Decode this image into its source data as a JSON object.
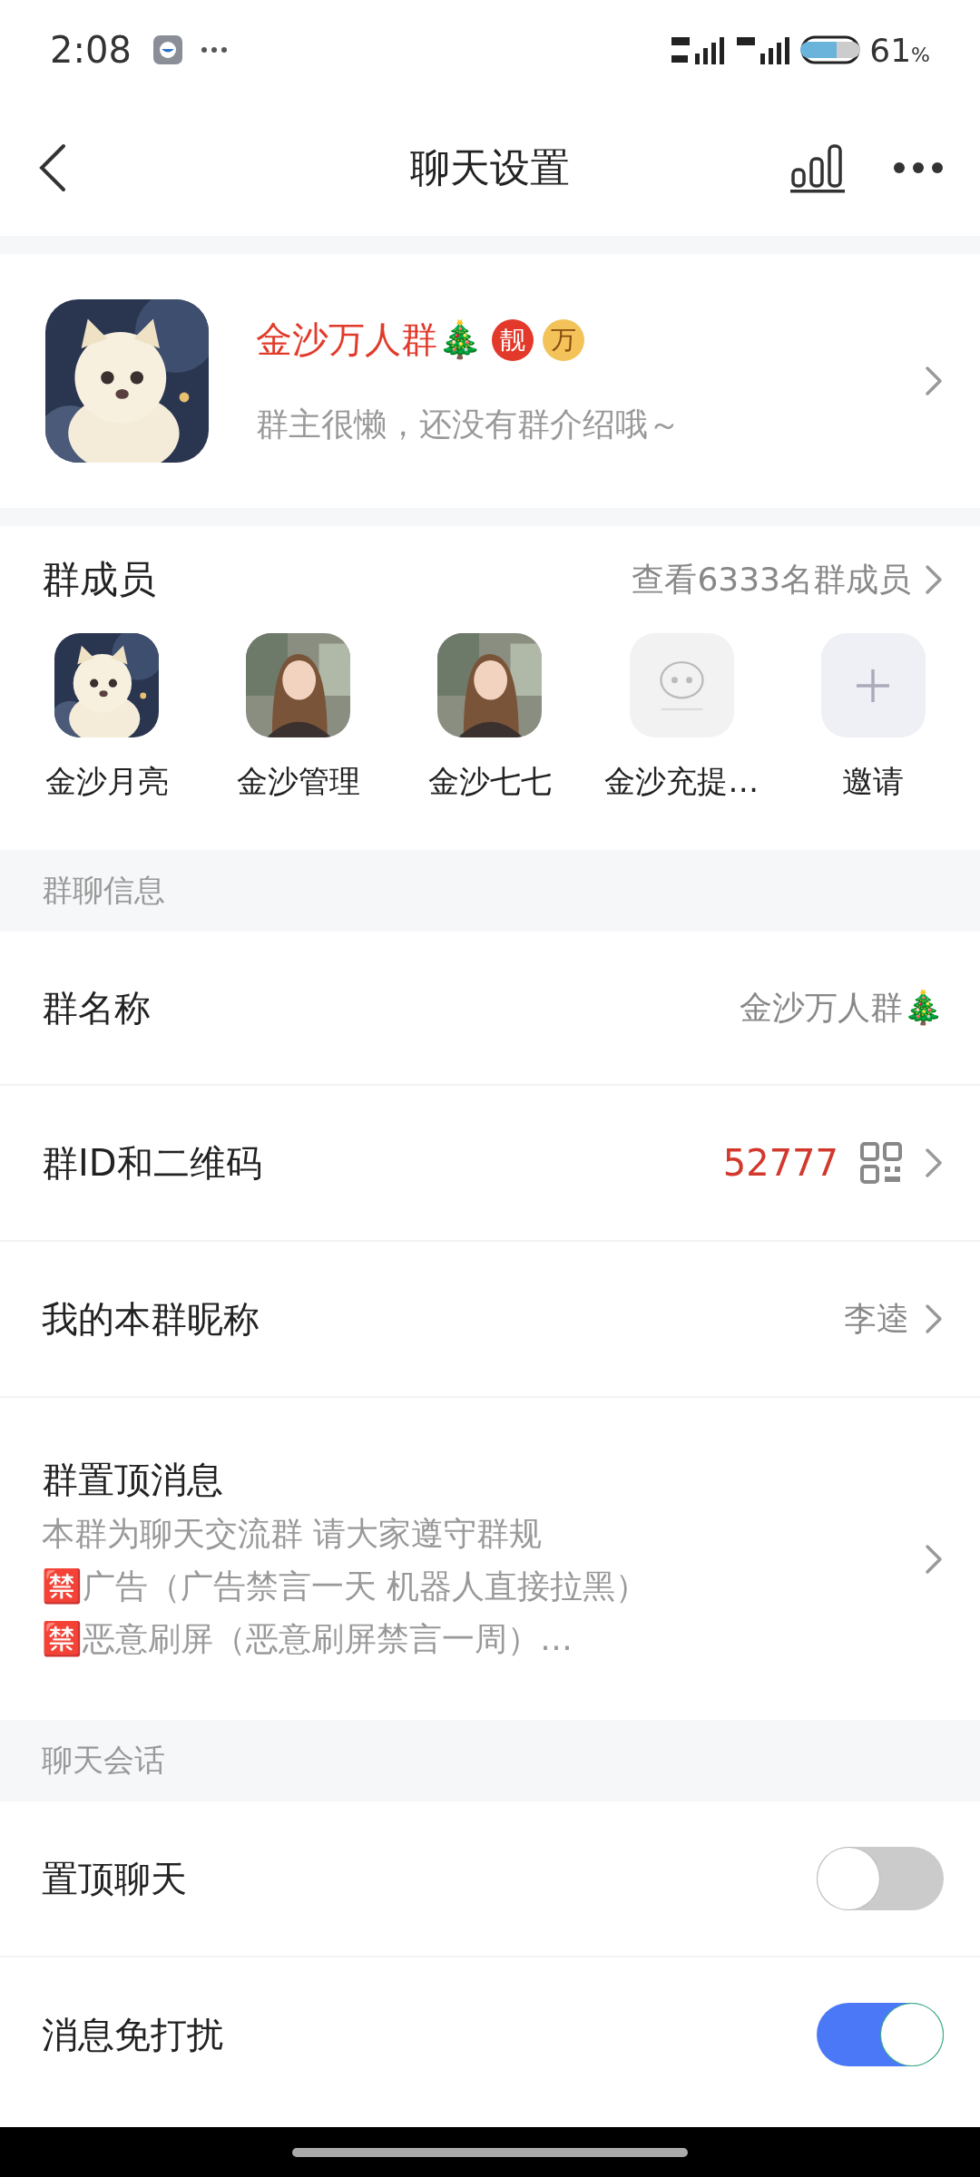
{
  "status_bar": {
    "time": "2:08",
    "battery": "61",
    "battery_unit": "%"
  },
  "header": {
    "title": "聊天设置"
  },
  "group": {
    "name": "金沙万人群🎄",
    "intro": "群主很懒，还没有群介绍哦～",
    "badges": [
      {
        "text": "靓",
        "color": "#e3392a"
      },
      {
        "text": "万",
        "color": "#f3c35a"
      }
    ]
  },
  "members": {
    "title": "群成员",
    "link": "查看6333名群成员",
    "items": [
      {
        "name": "金沙月亮",
        "kind": "pet"
      },
      {
        "name": "金沙管理",
        "kind": "person"
      },
      {
        "name": "金沙七七",
        "kind": "person"
      },
      {
        "name": "金沙充提…",
        "kind": "placeholder"
      },
      {
        "name": "邀请",
        "kind": "invite"
      }
    ]
  },
  "sections": [
    {
      "title": "群聊信息",
      "rows": [
        {
          "kind": "text",
          "label": "群名称",
          "value": "金沙万人群🎄"
        },
        {
          "kind": "code",
          "label": "群ID和二维码",
          "value": "52777"
        },
        {
          "kind": "link",
          "label": "我的本群昵称",
          "value": "李逵"
        },
        {
          "kind": "notice",
          "label": "群置顶消息",
          "lines": [
            "本群为聊天交流群 请大家遵守群规",
            "🈲广告（广告禁言一天 机器人直接拉黑）",
            "🈲恶意刷屏（恶意刷屏禁言一周）…"
          ]
        }
      ]
    },
    {
      "title": "聊天会话",
      "rows": [
        {
          "kind": "toggle",
          "label": "置顶聊天",
          "on": false
        },
        {
          "kind": "toggle",
          "label": "消息免打扰",
          "on": true
        }
      ]
    }
  ]
}
